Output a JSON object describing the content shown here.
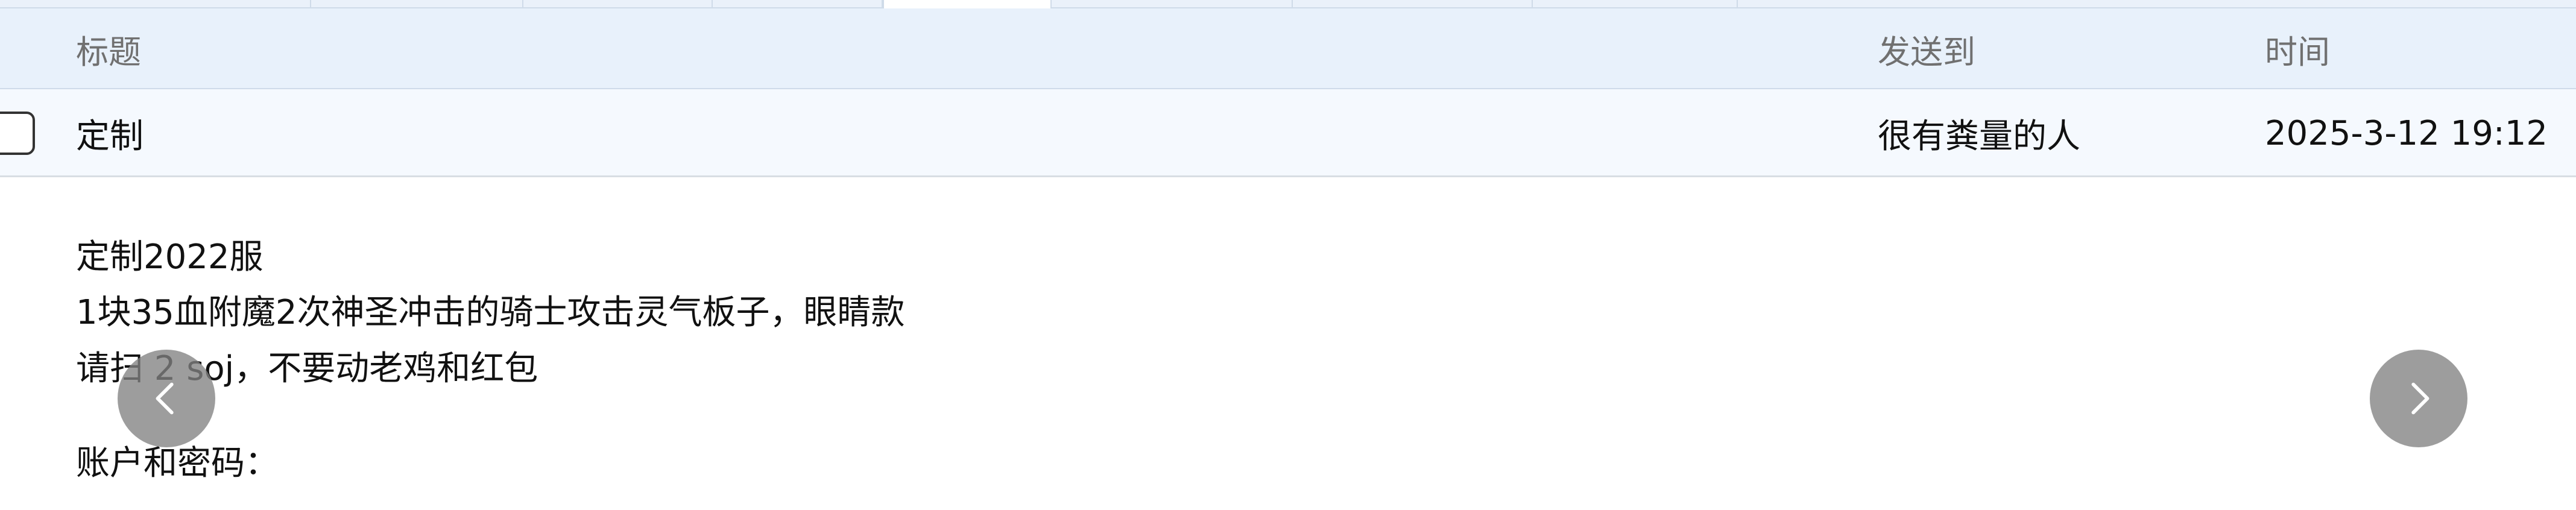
{
  "header": {
    "col_subject": "标题",
    "col_recipient": "发送到",
    "col_time": "时间"
  },
  "message": {
    "subject": "定制",
    "recipient": "很有粪量的人",
    "time": "2025-3-12 19:12",
    "checked": false
  },
  "body": {
    "lines": [
      "定制2022服",
      "1块35血附魔2次神圣冲击的骑士攻击灵气板子，眼睛款",
      "请扫    2 soj，不要动老鸡和红包",
      "账户和密码："
    ]
  },
  "icons": {
    "prev": "chevron-left-icon",
    "next": "chevron-right-icon"
  }
}
